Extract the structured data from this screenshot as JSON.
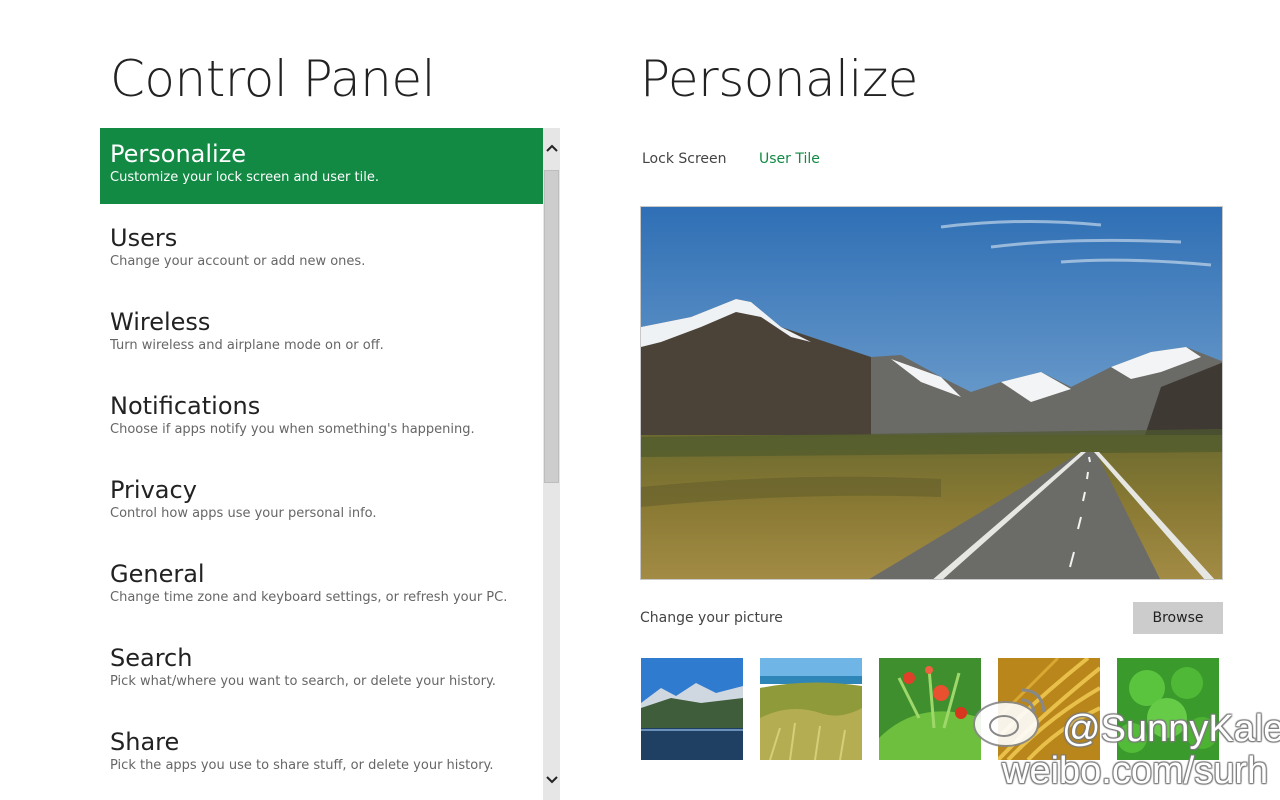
{
  "left_panel": {
    "title": "Control Panel"
  },
  "categories": [
    {
      "title": "Personalize",
      "desc": "Customize your lock screen and user tile.",
      "selected": true
    },
    {
      "title": "Users",
      "desc": "Change your account or add new ones."
    },
    {
      "title": "Wireless",
      "desc": "Turn wireless and airplane mode on or off."
    },
    {
      "title": "Notifications",
      "desc": "Choose if apps notify you when something's happening."
    },
    {
      "title": "Privacy",
      "desc": "Control how apps use your personal info."
    },
    {
      "title": "General",
      "desc": "Change time zone and keyboard settings, or refresh your PC."
    },
    {
      "title": "Search",
      "desc": "Pick what/where you want to search, or delete your history."
    },
    {
      "title": "Share",
      "desc": "Pick the apps you use to share stuff, or delete your history."
    }
  ],
  "right_panel": {
    "title": "Personalize",
    "tabs": [
      {
        "label": "Lock Screen",
        "active": false
      },
      {
        "label": "User Tile",
        "active": true
      }
    ],
    "change_picture_label": "Change your picture",
    "browse_label": "Browse"
  },
  "colors": {
    "accent": "#128a44",
    "scrollbar_track": "#e6e6e6",
    "button": "#cccccc"
  },
  "icons": {
    "scroll_up": "chevron-up-icon",
    "scroll_down": "chevron-down-icon"
  },
  "watermark": {
    "handle": "@SunnyKale",
    "url": "weibo.com/surh"
  }
}
